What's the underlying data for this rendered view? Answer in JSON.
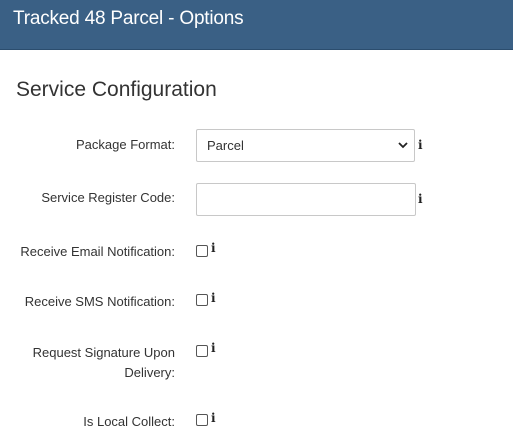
{
  "window": {
    "title": "Tracked 48 Parcel - Options"
  },
  "section": {
    "title": "Service Configuration"
  },
  "fields": {
    "package_format": {
      "label": "Package Format:",
      "value": "Parcel"
    },
    "service_register_code": {
      "label": "Service Register Code:",
      "value": ""
    },
    "email_notification": {
      "label": "Receive Email Notification:",
      "checked": false
    },
    "sms_notification": {
      "label": "Receive SMS Notification:",
      "checked": false
    },
    "signature_line1": "Request Signature Upon",
    "signature_line2": "Delivery:",
    "local_collect": {
      "label": "Is Local Collect:",
      "checked": false
    }
  },
  "icons": {
    "info": "info-icon",
    "dropdown": "chevron-down-icon"
  },
  "info_glyph": "i",
  "colors": {
    "titlebar": "#3a6085",
    "title_text": "#ffffff"
  }
}
